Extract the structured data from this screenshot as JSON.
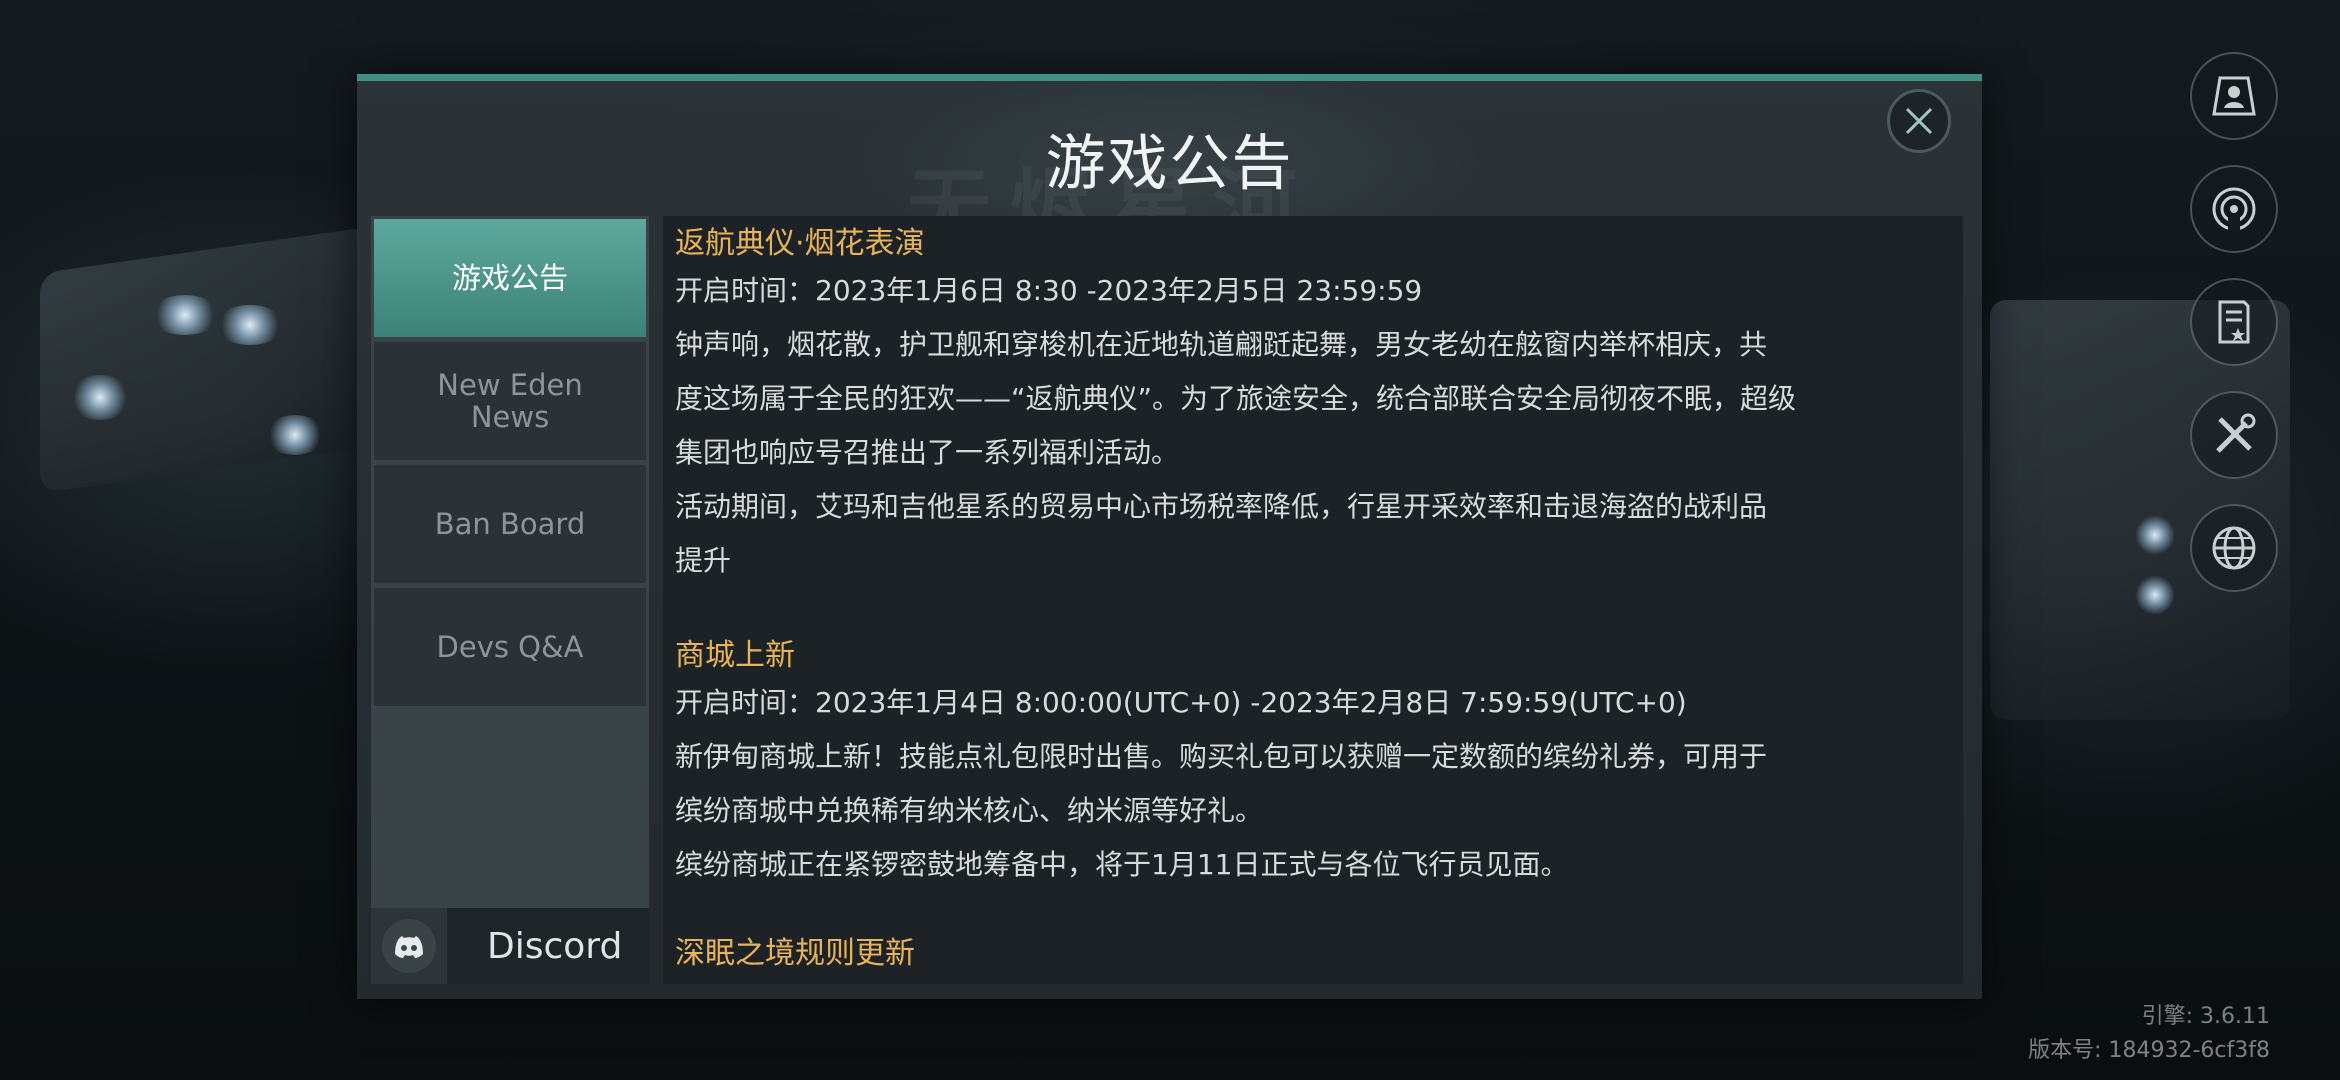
{
  "dialog": {
    "title": "游戏公告",
    "watermark": "无烬星河",
    "close_icon": "close-icon"
  },
  "tabs": [
    {
      "label": "游戏公告",
      "active": true
    },
    {
      "label": "New Eden News",
      "active": false
    },
    {
      "label": "Ban Board",
      "active": false
    },
    {
      "label": "Devs Q&A",
      "active": false
    }
  ],
  "discord": {
    "label": "Discord",
    "icon": "discord-icon"
  },
  "announcements": [
    {
      "title": "返航典仪·烟花表演",
      "lines": [
        "开启时间：2023年1月6日 8:30 -2023年2月5日 23:59:59",
        "钟声响，烟花散，护卫舰和穿梭机在近地轨道翩跹起舞，男女老幼在舷窗内举杯相庆，共",
        "度这场属于全民的狂欢——“返航典仪”。为了旅途安全，统合部联合安全局彻夜不眠，超级",
        "集团也响应号召推出了一系列福利活动。",
        "活动期间，艾玛和吉他星系的贸易中心市场税率降低，行星开采效率和击退海盗的战利品",
        "提升"
      ]
    },
    {
      "title": "商城上新",
      "lines": [
        "开启时间：2023年1月4日 8:00:00(UTC+0) -2023年2月8日 7:59:59(UTC+0)",
        "新伊甸商城上新！技能点礼包限时出售。购买礼包可以获赠一定数额的缤纷礼券，可用于",
        "缤纷商城中兑换稀有纳米核心、纳米源等好礼。",
        "缤纷商城正在紧锣密鼓地筹备中，将于1月11日正式与各位飞行员见面。"
      ]
    },
    {
      "title": "深眠之境规则更新",
      "lines": []
    }
  ],
  "side_icons": [
    "profile-icon",
    "signal-icon",
    "notes-icon",
    "settings-tools-icon",
    "globe-icon"
  ],
  "version": {
    "engine": "引擎: 3.6.11",
    "build": "版本号: 184932-6cf3f8"
  },
  "colors": {
    "accent": "#3f8f83",
    "section_title": "#e8b45a",
    "tab_active": "#4f978b"
  }
}
